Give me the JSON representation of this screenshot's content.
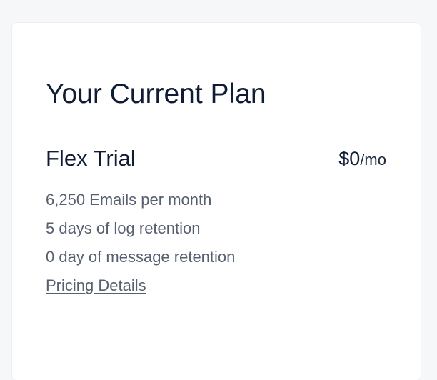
{
  "plan_card": {
    "title": "Your Current Plan",
    "plan_name": "Flex Trial",
    "price_amount": "$0",
    "price_unit": "/mo",
    "features": [
      "6,250 Emails per month",
      "5 days of log retention",
      "0 day of message retention"
    ],
    "pricing_link": "Pricing Details"
  },
  "colors": {
    "background": "#f6f7f9",
    "card": "#ffffff",
    "heading_text": "#0f1c33",
    "muted_text": "#56606f"
  }
}
